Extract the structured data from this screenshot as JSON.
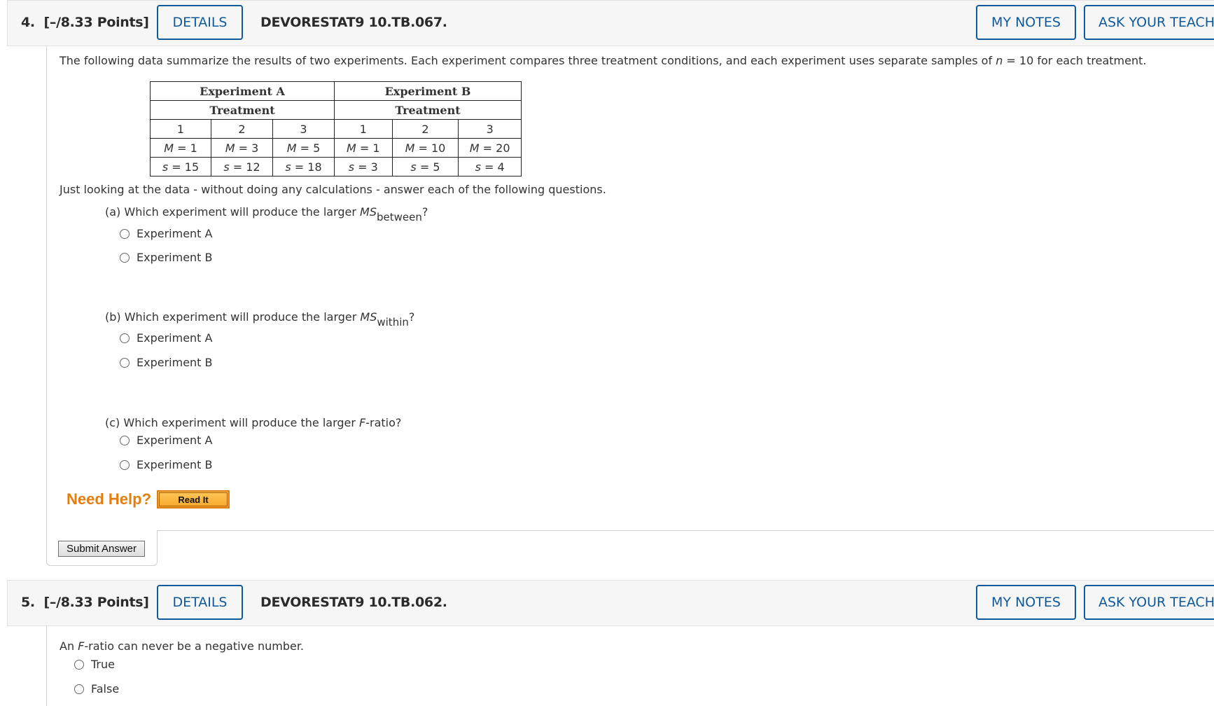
{
  "questions": [
    {
      "number": "4.",
      "points": "[–/8.33 Points]",
      "details_label": "DETAILS",
      "code": "DEVORESTAT9 10.TB.067.",
      "my_notes_label": "MY NOTES",
      "ask_teacher_label": "ASK YOUR TEACH",
      "intro_pre": "The following data summarize the results of two experiments. Each experiment compares three treatment conditions, and each experiment uses separate samples of ",
      "intro_var": "n",
      "intro_post": " = 10 for each treatment.",
      "table": {
        "experiments": [
          "Experiment A",
          "Experiment B"
        ],
        "treatment_label": "Treatment",
        "treatments": [
          "1",
          "2",
          "3",
          "1",
          "2",
          "3"
        ],
        "means": [
          "1",
          "3",
          "5",
          "1",
          "10",
          "20"
        ],
        "sds": [
          "15",
          "12",
          "18",
          "3",
          "5",
          "4"
        ],
        "mean_symbol": "M",
        "sd_symbol": "s"
      },
      "instruction": "Just looking at the data - without doing any calculations - answer each of the following questions.",
      "parts": [
        {
          "prefix": "(a) Which experiment will produce the larger ",
          "var": "MS",
          "sub": "between",
          "suffix": "?",
          "options": [
            "Experiment A",
            "Experiment B"
          ]
        },
        {
          "prefix": "(b) Which experiment will produce the larger ",
          "var": "MS",
          "sub": "within",
          "suffix": "?",
          "options": [
            "Experiment A",
            "Experiment B"
          ]
        },
        {
          "prefix": "(c) Which experiment will produce the larger ",
          "var": "F",
          "sub": "",
          "suffix": "-ratio?",
          "options": [
            "Experiment A",
            "Experiment B"
          ]
        }
      ],
      "need_help": "Need Help?",
      "read_it_label": "Read It",
      "submit_label": "Submit Answer"
    },
    {
      "number": "5.",
      "points": "[–/8.33 Points]",
      "details_label": "DETAILS",
      "code": "DEVORESTAT9 10.TB.062.",
      "my_notes_label": "MY NOTES",
      "ask_teacher_label": "ASK YOUR TEACH",
      "statement_pre": "An ",
      "statement_var": "F",
      "statement_post": "-ratio can never be a negative number.",
      "options": [
        "True",
        "False"
      ]
    }
  ]
}
